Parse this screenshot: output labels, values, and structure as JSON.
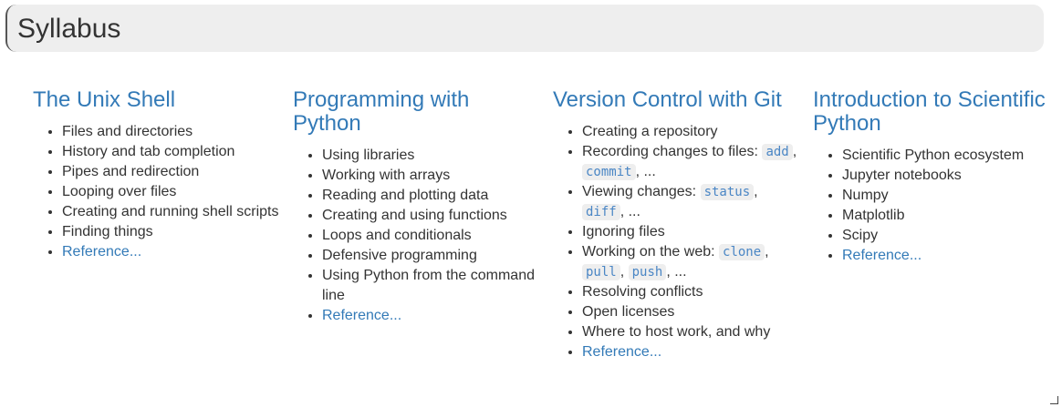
{
  "banner": {
    "title": "Syllabus"
  },
  "columns": [
    {
      "title": "The Unix Shell",
      "items": [
        "Files and directories",
        "History and tab completion",
        "Pipes and redirection",
        "Looping over files",
        "Creating and running shell scripts",
        "Finding things"
      ],
      "reference": "Reference..."
    },
    {
      "title": "Programming with Python",
      "items": [
        "Using libraries",
        "Working with arrays",
        "Reading and plotting data",
        "Creating and using functions",
        "Loops and conditionals",
        "Defensive programming",
        "Using Python from the command line"
      ],
      "reference": "Reference..."
    },
    {
      "title": "Version Control with Git",
      "items": {
        "creating_repo": "Creating a repository",
        "recording": {
          "text": "Recording changes to files: ",
          "codes": [
            "add",
            "commit"
          ],
          "tail": ", ..."
        },
        "viewing": {
          "text": "Viewing changes: ",
          "codes": [
            "status",
            "diff"
          ],
          "tail": ", ..."
        },
        "ignoring": "Ignoring files",
        "web": {
          "text": "Working on the web: ",
          "codes": [
            "clone",
            "pull",
            "push"
          ],
          "tail": ", ..."
        },
        "conflicts": "Resolving conflicts",
        "licenses": "Open licenses",
        "hosting": "Where to host work, and why"
      },
      "reference": "Reference..."
    },
    {
      "title": "Introduction to Scientific Python",
      "items": [
        "Scientific Python ecosystem",
        "Jupyter notebooks",
        "Numpy",
        "Matplotlib",
        "Scipy"
      ],
      "reference": "Reference..."
    }
  ],
  "separator": ", "
}
